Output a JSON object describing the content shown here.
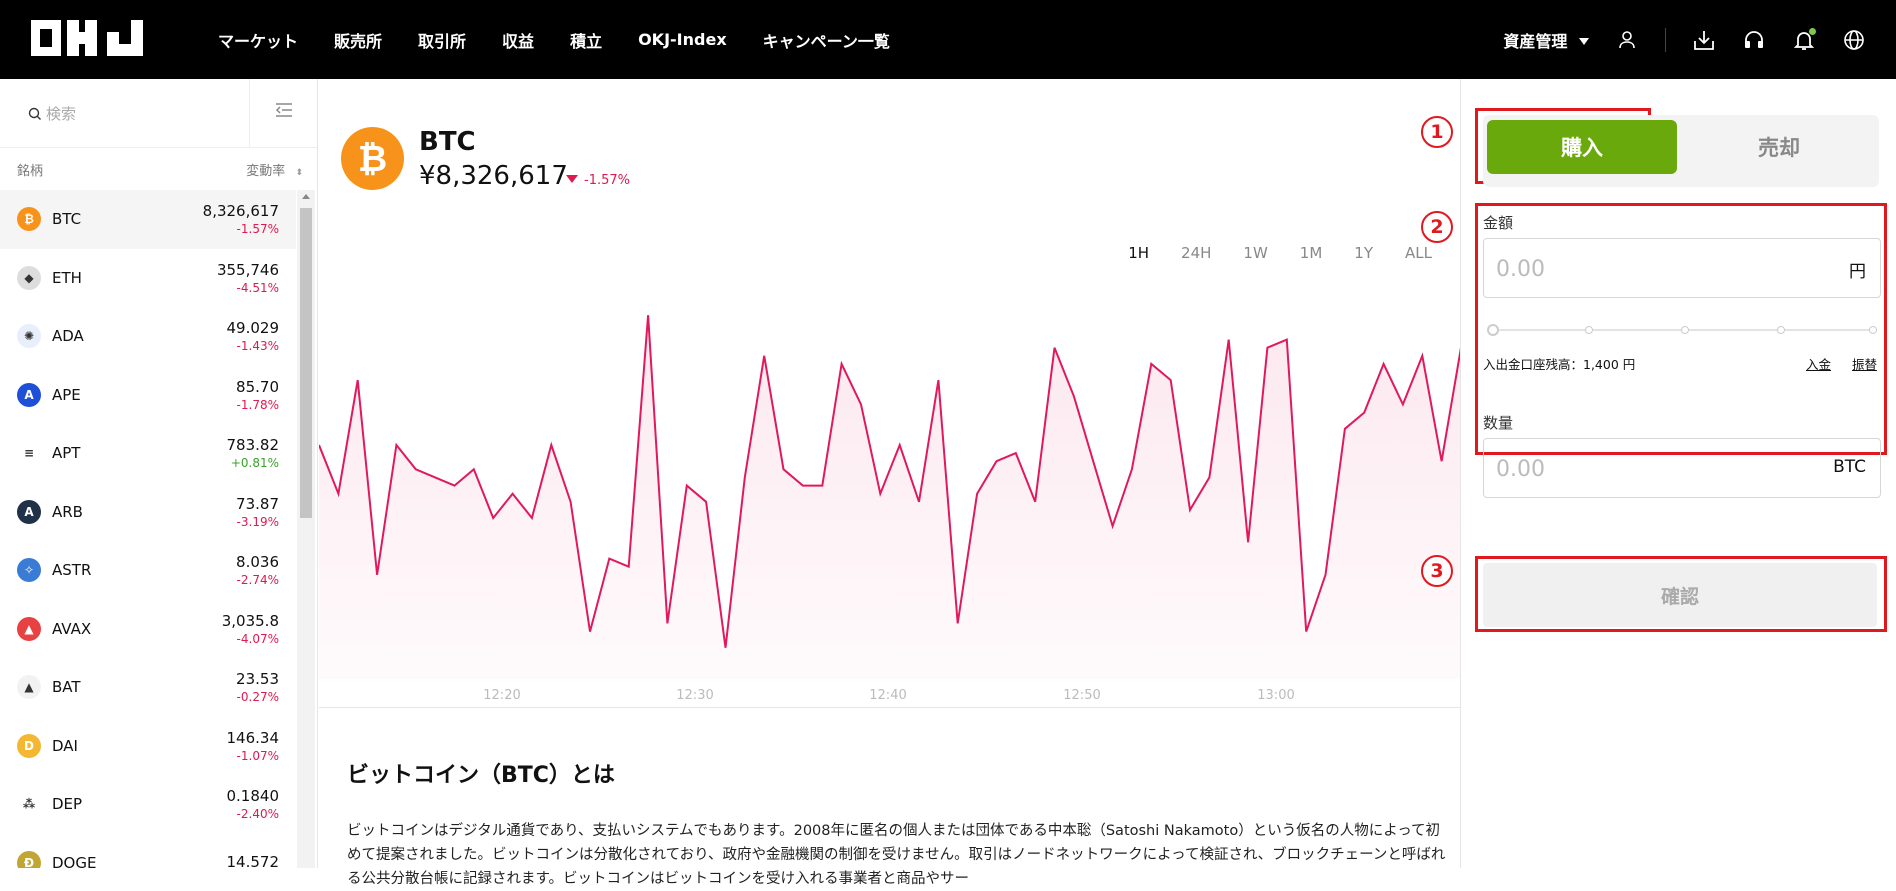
{
  "header": {
    "nav": [
      "マーケット",
      "販売所",
      "取引所",
      "収益",
      "積立",
      "OKJ-Index",
      "キャンペーン一覧"
    ],
    "asset_menu": "資産管理"
  },
  "sidebar": {
    "search_placeholder": "検索",
    "col_symbol": "銘柄",
    "col_change": "変動率",
    "coins": [
      {
        "name": "BTC",
        "price": "8,326,617",
        "change": "-1.57%",
        "color": "#f7931a",
        "glyph": "₿"
      },
      {
        "name": "ETH",
        "price": "355,746",
        "change": "-4.51%",
        "color": "#dddddd",
        "glyph": "◆"
      },
      {
        "name": "ADA",
        "price": "49.029",
        "change": "-1.43%",
        "color": "#e8eefc",
        "glyph": "✺"
      },
      {
        "name": "APE",
        "price": "85.70",
        "change": "-1.78%",
        "color": "#1d4fd8",
        "glyph": "A"
      },
      {
        "name": "APT",
        "price": "783.82",
        "change": "+0.81%",
        "color": "#ffffff",
        "glyph": "≡"
      },
      {
        "name": "ARB",
        "price": "73.87",
        "change": "-3.19%",
        "color": "#213147",
        "glyph": "A"
      },
      {
        "name": "ASTR",
        "price": "8.036",
        "change": "-2.74%",
        "color": "#3a7bd5",
        "glyph": "✧"
      },
      {
        "name": "AVAX",
        "price": "3,035.8",
        "change": "-4.07%",
        "color": "#e84142",
        "glyph": "▲"
      },
      {
        "name": "BAT",
        "price": "23.53",
        "change": "-0.27%",
        "color": "#f2f2f2",
        "glyph": "▲"
      },
      {
        "name": "DAI",
        "price": "146.34",
        "change": "-1.07%",
        "color": "#f4b731",
        "glyph": "D"
      },
      {
        "name": "DEP",
        "price": "0.1840",
        "change": "-2.40%",
        "color": "#ffffff",
        "glyph": "⁂"
      },
      {
        "name": "DOGE",
        "price": "14.572",
        "change": "",
        "color": "#c2a633",
        "glyph": "Ð"
      }
    ]
  },
  "main": {
    "symbol": "BTC",
    "price": "¥8,326,617",
    "change": "-1.57%",
    "ranges": [
      "1H",
      "24H",
      "1W",
      "1M",
      "1Y",
      "ALL"
    ],
    "selected_range": "1H",
    "about_title": "ビットコイン（BTC）とは",
    "about_text": "ビットコインはデジタル通貨であり、支払いシステムでもあります。2008年に匿名の個人または団体である中本聡（Satoshi Nakamoto）という仮名の人物によって初めて提案されました。ビットコインは分散化されており、政府や金融機関の制御を受けません。取引はノードネットワークによって検証され、ブロックチェーンと呼ばれる公共分散台帳に記録されます。ビットコインはビットコインを受け入れる事業者と商品やサー"
  },
  "chart_data": {
    "type": "line",
    "x_ticks": [
      "12:20",
      "12:30",
      "12:40",
      "12:50",
      "13:00"
    ],
    "line_color": "#e0195f",
    "values": [
      62,
      56,
      70,
      46,
      62,
      59,
      58,
      57,
      59,
      53,
      56,
      53,
      62,
      55,
      39,
      48,
      47,
      78,
      40,
      57,
      55,
      37,
      58,
      73,
      59,
      57,
      57,
      72,
      67,
      56,
      62,
      55,
      70,
      40,
      56,
      60,
      61,
      55,
      74,
      68,
      60,
      52,
      59,
      72,
      70,
      54,
      58,
      75,
      50,
      74,
      75,
      39,
      46,
      64,
      66,
      72,
      67,
      73,
      60,
      74
    ]
  },
  "panel": {
    "num1": "1",
    "num2": "2",
    "num3": "3",
    "buy": "購入",
    "sell": "売却",
    "amount_label": "金額",
    "amount_placeholder": "0.00",
    "amount_unit": "円",
    "balance": "入出金口座残高：1,400 円",
    "deposit": "入金",
    "transfer": "振替",
    "qty_label": "数量",
    "qty_placeholder": "0.00",
    "qty_unit": "BTC",
    "confirm": "確認"
  }
}
